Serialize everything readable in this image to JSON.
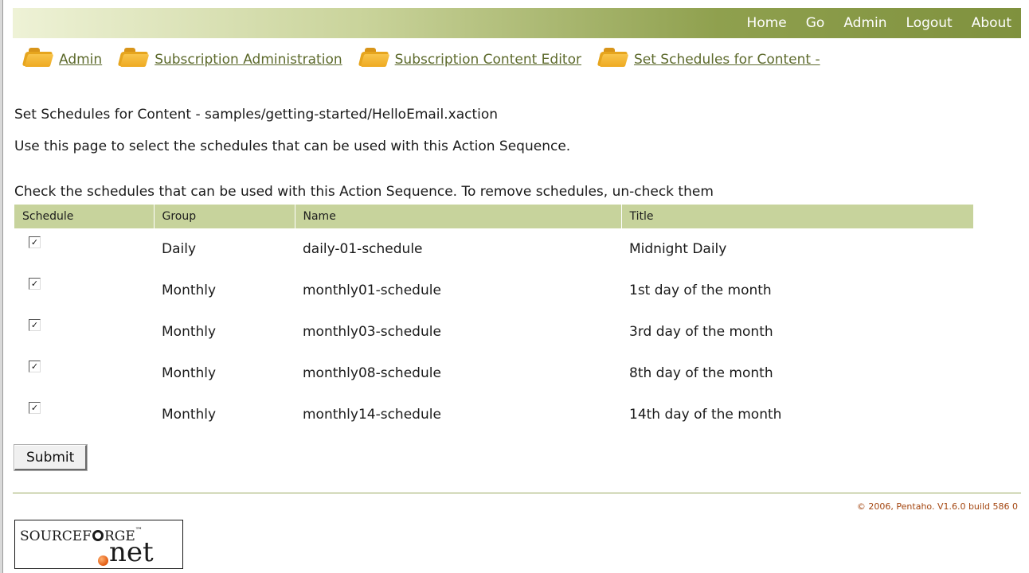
{
  "nav": {
    "items": [
      "Home",
      "Go",
      "Admin",
      "Logout",
      "About"
    ]
  },
  "breadcrumb": [
    "Admin",
    "Subscription Administration",
    "Subscription Content Editor",
    "Set Schedules for Content -"
  ],
  "page": {
    "title": "Set Schedules for Content - samples/getting-started/HelloEmail.xaction",
    "description": "Use this page to select the schedules that can be used with this Action Sequence.",
    "instructions": "Check the schedules that can be used with this Action Sequence. To remove schedules, un-check them"
  },
  "table": {
    "headers": [
      "Schedule",
      "Group",
      "Name",
      "Title"
    ],
    "rows": [
      {
        "checked": true,
        "group": "Daily",
        "name": "daily-01-schedule",
        "title": "Midnight Daily"
      },
      {
        "checked": true,
        "group": "Monthly",
        "name": "monthly01-schedule",
        "title": "1st day of the month"
      },
      {
        "checked": true,
        "group": "Monthly",
        "name": "monthly03-schedule",
        "title": "3rd day of the month"
      },
      {
        "checked": true,
        "group": "Monthly",
        "name": "monthly08-schedule",
        "title": "8th day of the month"
      },
      {
        "checked": true,
        "group": "Monthly",
        "name": "monthly14-schedule",
        "title": "14th day of the month"
      }
    ]
  },
  "submit_label": "Submit",
  "footer": {
    "copyright": "© 2006, Pentaho. V1.6.0 build 586 0",
    "logo_text": "SOURCEFORGE.net"
  },
  "colors": {
    "header_bar": "#8fa04e",
    "table_header": "#c7d39c",
    "link": "#5d6a2c",
    "copyright": "#a3450f"
  },
  "icons": {
    "breadcrumb": "folder-icon",
    "checkbox": "checkmark-icon"
  }
}
